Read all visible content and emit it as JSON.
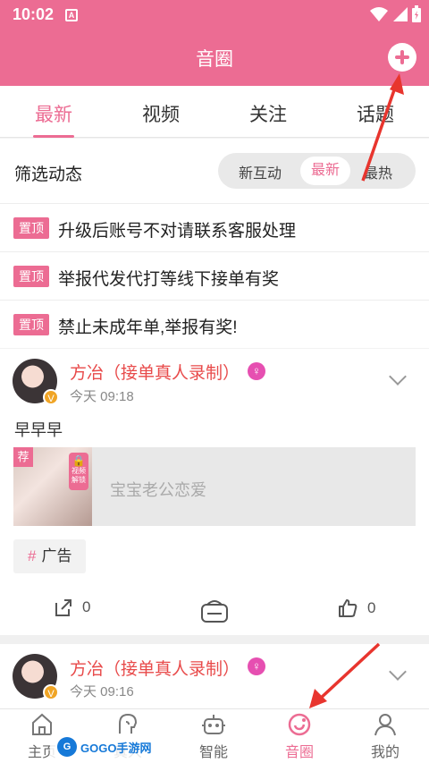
{
  "status_bar": {
    "time": "10:02",
    "notification_icon": "A"
  },
  "header": {
    "title": "音圈"
  },
  "tabs": [
    {
      "label": "最新",
      "active": true
    },
    {
      "label": "视频",
      "active": false
    },
    {
      "label": "关注",
      "active": false
    },
    {
      "label": "话题",
      "active": false
    }
  ],
  "filter": {
    "label": "筛选动态",
    "options": [
      "新互动",
      "最新",
      "最热"
    ],
    "selected": "最新"
  },
  "pinned": [
    {
      "tag": "置顶",
      "text": "升级后账号不对请联系客服处理"
    },
    {
      "tag": "置顶",
      "text": "举报代发代打等线下接单有奖"
    },
    {
      "tag": "置顶",
      "text": "禁止未成年单,举报有奖!"
    }
  ],
  "posts": [
    {
      "user": "方冶（接单真人录制）",
      "gender_symbol": "♀",
      "verified_badge": "V",
      "time": "今天 09:18",
      "content": "早早早",
      "media": {
        "badge": "荐",
        "lock_text": "视频解锁",
        "title": "宝宝老公恋爱"
      },
      "hashtag_symbol": "#",
      "hashtag": "广告",
      "share_count": "0",
      "like_count": "0"
    },
    {
      "user": "方冶（接单真人录制）",
      "gender_symbol": "♀",
      "verified_badge": "V",
      "time": "今天 09:16"
    }
  ],
  "bottom_nav": [
    {
      "label": "主页",
      "icon": "home-icon"
    },
    {
      "label": "真人",
      "icon": "person-voice-icon"
    },
    {
      "label": "智能",
      "icon": "robot-icon"
    },
    {
      "label": "音圈",
      "icon": "circle-refresh-icon",
      "active": true
    },
    {
      "label": "我的",
      "icon": "profile-icon"
    }
  ],
  "watermark": {
    "logo": "G",
    "text": "GOGO手游网"
  },
  "colors": {
    "brand": "#ec6c93",
    "username": "#e84a4a",
    "gender": "#e64fb1",
    "annotation_arrow": "#e8352e"
  }
}
